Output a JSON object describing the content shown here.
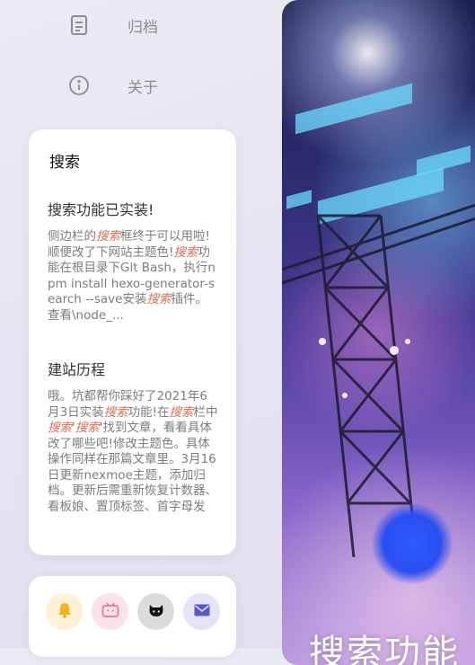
{
  "nav": {
    "archive_label": "归档",
    "about_label": "关于",
    "archive_icon": "archive-icon",
    "about_icon": "info-icon"
  },
  "search": {
    "title": "搜索",
    "posts": [
      {
        "title": "搜索功能已实装!",
        "excerpt": [
          "侧边栏的",
          "搜索",
          "框终于可以用啦!顺便改了下网站主题色!",
          "搜索",
          "功能在根目录下Git Bash，执行npm install hexo-generator-search --save安装",
          "搜索",
          "插件。查看\\node_..."
        ]
      },
      {
        "title": "建站历程",
        "excerpt": [
          "哦。坑都帮你踩好了2021年6月3日实装",
          "搜索",
          "功能!在",
          "搜索",
          "栏中",
          "搜索",
          "'",
          "搜索",
          "'找到文章，看看具体改了哪些吧!修改主题色。具体操作同样在那篇文章里。3月16日更新nexmoe主题，添加归档。更新后需重新恢复计数器、看板娘、置顶标签、首字母发"
        ]
      }
    ]
  },
  "social": [
    {
      "name": "bell-icon",
      "color": "#f5b41c"
    },
    {
      "name": "bilibili-icon",
      "color": "#f07294"
    },
    {
      "name": "github-icon",
      "color": "#111111"
    },
    {
      "name": "mail-icon",
      "color": "#5a57c9"
    }
  ],
  "hero": {
    "title": "搜索功能"
  },
  "colors": {
    "highlight": "#e06b56",
    "card_bg": "#ffffff",
    "page_bg": "#e8e6f1"
  }
}
